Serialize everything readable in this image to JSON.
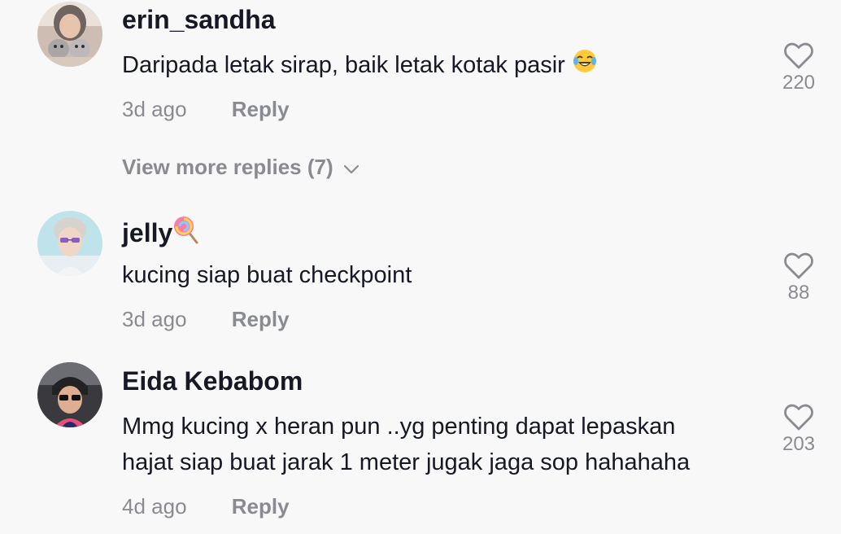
{
  "comments": [
    {
      "username": "erin_sandha",
      "text": "Daripada letak sirap, baik letak kotak pasir",
      "text_emoji": "laughing-tears-emoji",
      "time": "3d ago",
      "reply_label": "Reply",
      "likes": "220",
      "view_more": "View more replies (7)"
    },
    {
      "username": "jelly",
      "username_emoji": "lollipop-emoji",
      "text": "kucing siap buat checkpoint",
      "time": "3d ago",
      "reply_label": "Reply",
      "likes": "88"
    },
    {
      "username": "Eida Kebabom",
      "text_line1": "Mmg kucing x heran pun ..yg penting dapat lepaskan",
      "text_line2": "hajat siap buat jarak 1 meter jugak jaga sop hahahaha",
      "time": "4d ago",
      "reply_label": "Reply",
      "likes": "203"
    }
  ],
  "colors": {
    "background": "#f8f8f8",
    "primary_text": "#161823",
    "secondary_text": "#8a8b91"
  }
}
